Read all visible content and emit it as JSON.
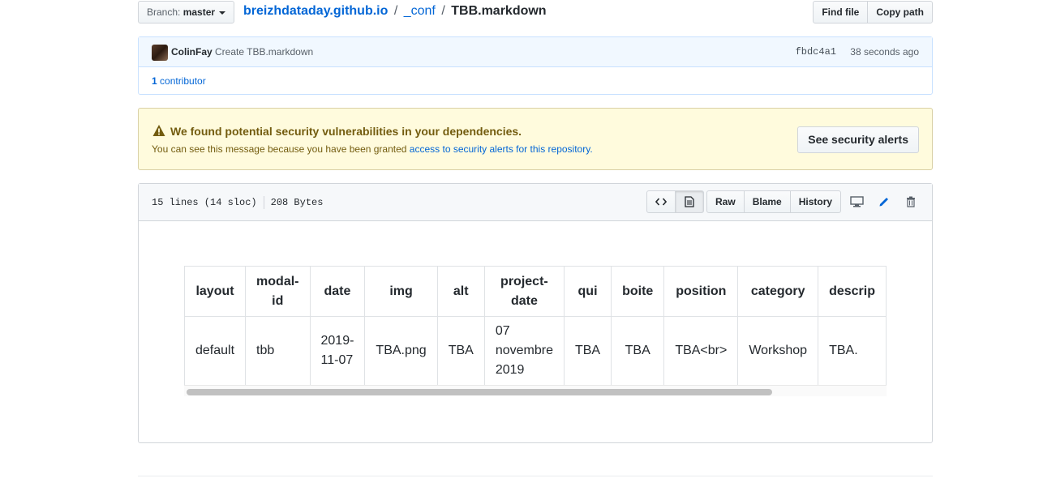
{
  "branch": {
    "prefix": "Branch:",
    "name": "master"
  },
  "breadcrumb": {
    "repo": "breizhdataday.github.io",
    "sep1": "/",
    "dir": "_conf",
    "sep2": "/",
    "file": "TBB.markdown"
  },
  "top_buttons": {
    "find_file": "Find file",
    "copy_path": "Copy path"
  },
  "commit": {
    "author": "ColinFay",
    "message": "Create TBB.markdown",
    "sha": "fbdc4a1",
    "time": "38 seconds ago",
    "contributors_count": "1",
    "contributors_label": "contributor"
  },
  "alert": {
    "title": "We found potential security vulnerabilities in your dependencies.",
    "text_prefix": "You can see this message because you have been granted ",
    "link": "access to security alerts for this repository.",
    "button": "See security alerts"
  },
  "file_info": {
    "lines": "15 lines (14 sloc)",
    "size": "208 Bytes"
  },
  "file_actions": {
    "raw": "Raw",
    "blame": "Blame",
    "history": "History"
  },
  "icons": {
    "warning": "alert-icon",
    "code": "code-icon",
    "file": "file-icon",
    "desktop": "desktop-icon",
    "edit": "pencil-icon",
    "delete": "trash-icon"
  },
  "table": {
    "headers": [
      "layout",
      "modal-\nid",
      "date",
      "img",
      "alt",
      "project-\ndate",
      "qui",
      "boite",
      "position",
      "category",
      "descrip"
    ],
    "row": [
      "default",
      "tbb",
      "2019-\n11-07",
      "TBA.png",
      "TBA",
      "07\nnovembre\n2019",
      "TBA",
      "TBA",
      "TBA<br>",
      "Workshop",
      "TBA."
    ]
  }
}
